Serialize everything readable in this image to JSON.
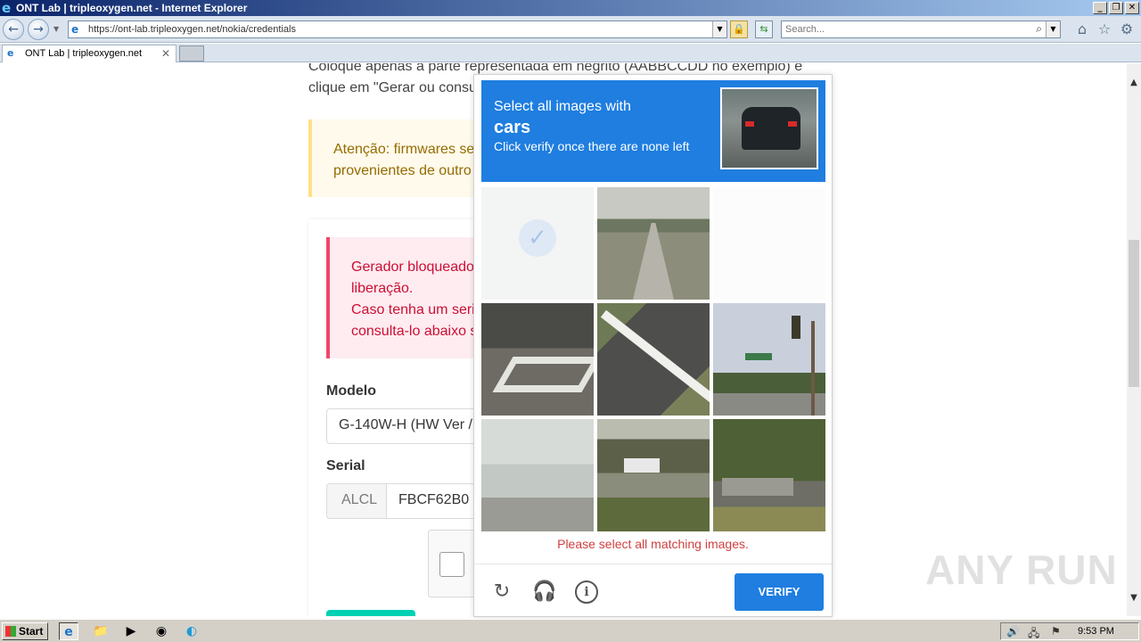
{
  "window": {
    "title": "ONT Lab | tripleoxygen.net - Internet Explorer",
    "url": "https://ont-lab.tripleoxygen.net/nokia/credentials",
    "search_placeholder": "Search...",
    "tab_label": "ONT Lab | tripleoxygen.net"
  },
  "page": {
    "intro_line1": "Coloque apenas a parte representada em negrito (AABBCCDD no exemplo) e",
    "intro_line2": "clique em \"Gerar ou consu",
    "warn_line1": "Atenção: firmwares ser",
    "warn_line2": "provenientes de outro",
    "danger_line1": "Gerador bloqueado",
    "danger_line2": "liberação.",
    "danger_line3": "Caso tenha um seria",
    "danger_line4": "consulta-lo abaixo s",
    "modelo_label": "Modelo",
    "modelo_value": "G-140W-H (HW Ver /",
    "serial_label": "Serial",
    "serial_prefix": "ALCL",
    "serial_value": "FBCF62B0"
  },
  "captcha": {
    "prompt_line1": "Select all images with",
    "prompt_target": "cars",
    "prompt_line3": "Click verify once there are none left",
    "error": "Please select all matching images.",
    "verify_label": "VERIFY",
    "icons": [
      "refresh-icon",
      "headphones-icon",
      "info-icon"
    ],
    "tiles": [
      {
        "selected": true
      },
      {
        "selected": false
      },
      {
        "selected": false
      },
      {
        "selected": false
      },
      {
        "selected": false
      },
      {
        "selected": false
      },
      {
        "selected": false
      },
      {
        "selected": false
      },
      {
        "selected": false
      }
    ]
  },
  "watermark": "ANY RUN",
  "taskbar": {
    "start_label": "Start",
    "clock": "9:53 PM"
  }
}
